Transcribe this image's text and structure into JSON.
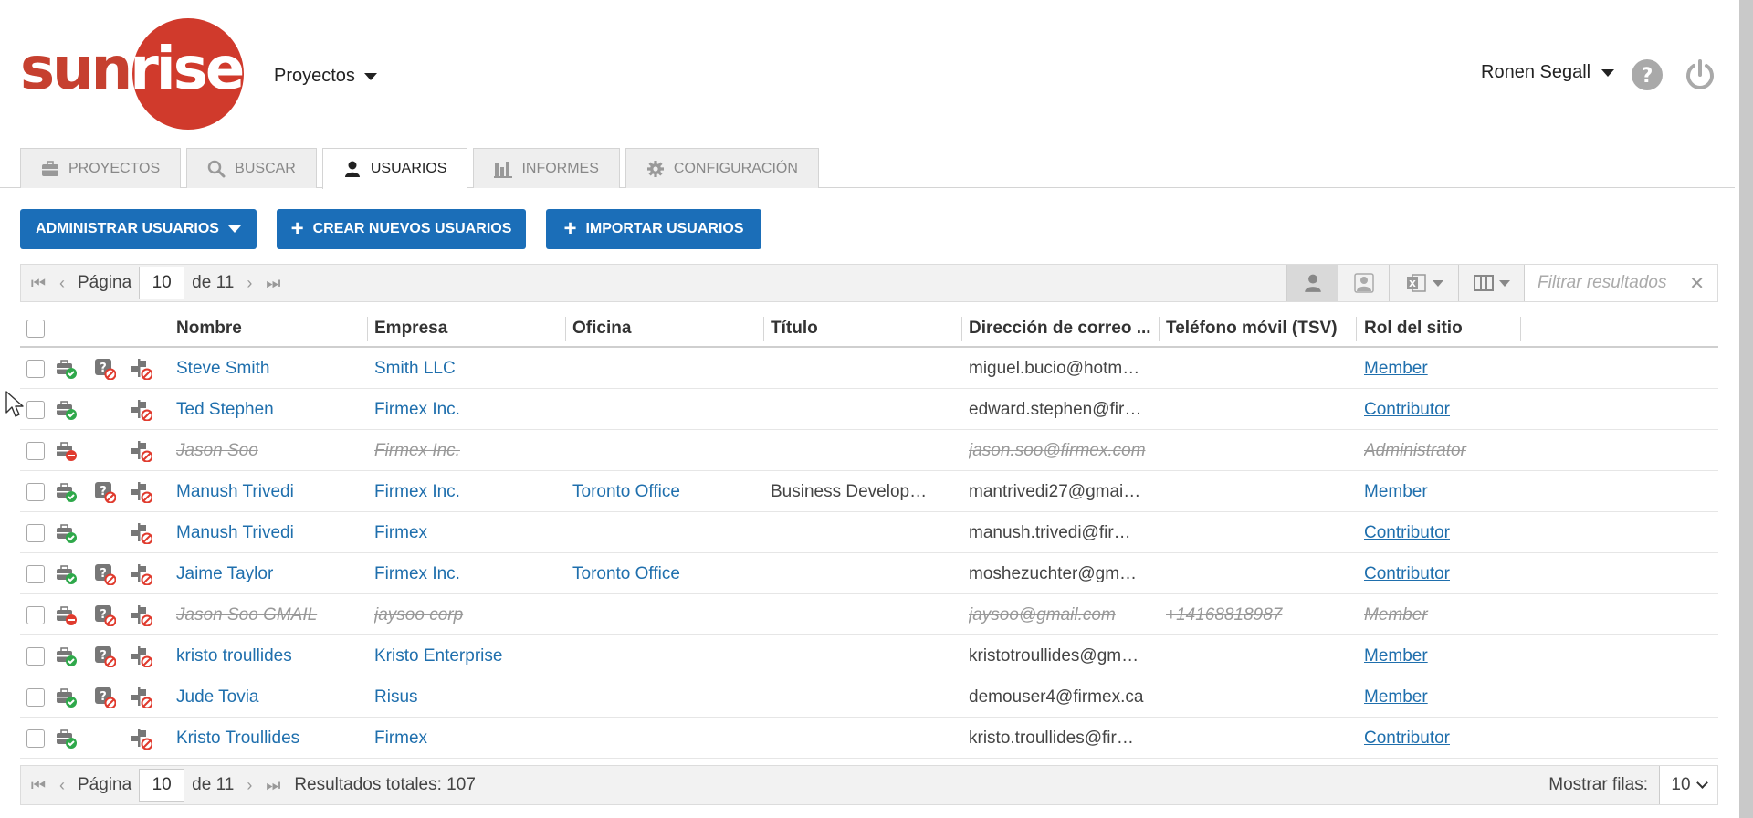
{
  "header": {
    "logo_text": "sunrise",
    "projects_menu": "Proyectos",
    "user_name": "Ronen Segall"
  },
  "tabs": [
    {
      "label": "PROYECTOS",
      "icon": "briefcase-icon",
      "active": false
    },
    {
      "label": "BUSCAR",
      "icon": "search-icon",
      "active": false
    },
    {
      "label": "USUARIOS",
      "icon": "user-icon",
      "active": true
    },
    {
      "label": "INFORMES",
      "icon": "bar-chart-icon",
      "active": false
    },
    {
      "label": "CONFIGURACIÓN",
      "icon": "gear-icon",
      "active": false
    }
  ],
  "actions": {
    "manage_users": "ADMINISTRAR USUARIOS",
    "create_users": "CREAR NUEVOS USUARIOS",
    "import_users": "IMPORTAR USUARIOS"
  },
  "pager": {
    "page_label": "Página",
    "current_page": "10",
    "of_label": "de 11",
    "total_results": "Resultados totales: 107"
  },
  "filter": {
    "placeholder": "Filtrar resultados"
  },
  "columns": {
    "name": "Nombre",
    "company": "Empresa",
    "office": "Oficina",
    "title": "Título",
    "email": "Dirección de correo ...",
    "phone": "Teléfono móvil (TSV)",
    "role": "Rol del sitio"
  },
  "users": [
    {
      "name": "Steve Smith",
      "company": "Smith LLC",
      "office": "",
      "title": "",
      "email": "miguel.bucio@hotm…",
      "phone": "",
      "role": "Member",
      "deleted": false,
      "status": "active",
      "question": true
    },
    {
      "name": "Ted Stephen",
      "company": "Firmex Inc.",
      "office": "",
      "title": "",
      "email": "edward.stephen@fir…",
      "phone": "",
      "role": "Contributor",
      "deleted": false,
      "status": "active",
      "question": false
    },
    {
      "name": "Jason Soo",
      "company": "Firmex Inc.",
      "office": "",
      "title": "",
      "email": "jason.soo@firmex.com",
      "phone": "",
      "role": "Administrator",
      "deleted": true,
      "status": "blocked",
      "question": false
    },
    {
      "name": "Manush Trivedi",
      "company": "Firmex Inc.",
      "office": "Toronto Office",
      "title": "Business Develop…",
      "email": "mantrivedi27@gmai…",
      "phone": "",
      "role": "Member",
      "deleted": false,
      "status": "active",
      "question": true
    },
    {
      "name": "Manush Trivedi",
      "company": "Firmex",
      "office": "",
      "title": "",
      "email": "manush.trivedi@fir…",
      "phone": "",
      "role": "Contributor",
      "deleted": false,
      "status": "active",
      "question": false
    },
    {
      "name": "Jaime Taylor",
      "company": "Firmex Inc.",
      "office": "Toronto Office",
      "title": "",
      "email": "moshezuchter@gm…",
      "phone": "",
      "role": "Contributor",
      "deleted": false,
      "status": "active",
      "question": true
    },
    {
      "name": "Jason Soo GMAIL",
      "company": "jaysoo corp",
      "office": "",
      "title": "",
      "email": "jaysoo@gmail.com",
      "phone": "+14168818987",
      "role": "Member",
      "deleted": true,
      "status": "blocked",
      "question": true
    },
    {
      "name": "kristo troullides",
      "company": "Kristo Enterprise",
      "office": "",
      "title": "",
      "email": "kristotroullides@gm…",
      "phone": "",
      "role": "Member",
      "deleted": false,
      "status": "active",
      "question": true
    },
    {
      "name": "Jude Tovia",
      "company": "Risus",
      "office": "",
      "title": "",
      "email": "demouser4@firmex.ca",
      "phone": "",
      "role": "Member",
      "deleted": false,
      "status": "active",
      "question": true
    },
    {
      "name": "Kristo Troullides",
      "company": "Firmex",
      "office": "",
      "title": "",
      "email": "kristo.troullides@fir…",
      "phone": "",
      "role": "Contributor",
      "deleted": false,
      "status": "active",
      "question": false
    }
  ],
  "footer": {
    "rows_label": "Mostrar filas:",
    "rows_value": "10"
  },
  "colors": {
    "primary": "#1b6eb8",
    "link": "#1f6fad",
    "logo_red": "#d03a2c",
    "ok_green": "#2ea84a",
    "block_red": "#e03b2e"
  }
}
